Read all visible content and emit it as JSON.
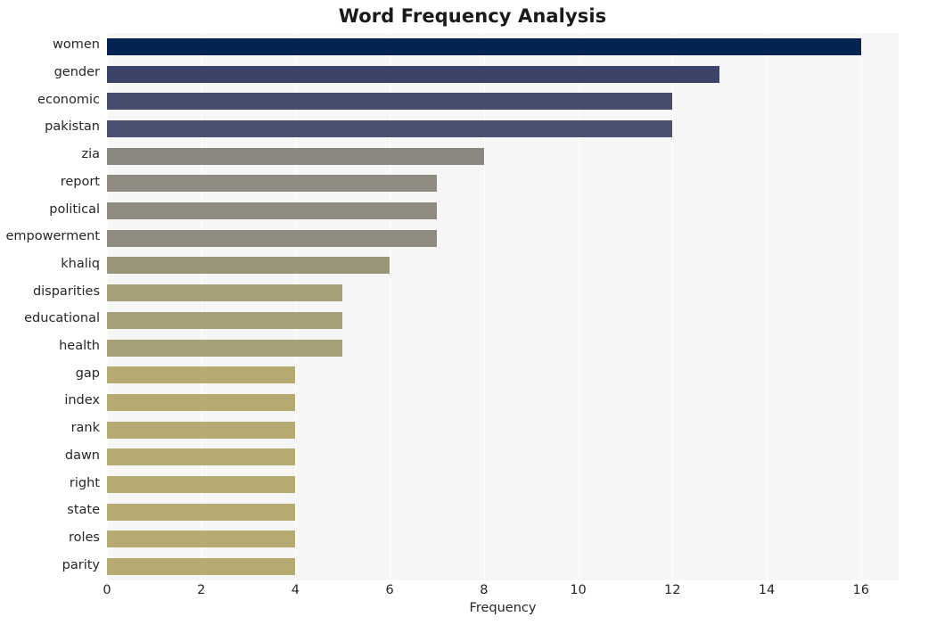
{
  "chart_data": {
    "type": "bar",
    "orientation": "horizontal",
    "title": "Word Frequency Analysis",
    "xlabel": "Frequency",
    "ylabel": "",
    "xlim": [
      0,
      16.8
    ],
    "xticks": [
      0,
      2,
      4,
      6,
      8,
      10,
      12,
      14,
      16
    ],
    "grid": "vertical",
    "legend": "none",
    "categories": [
      "women",
      "gender",
      "economic",
      "pakistan",
      "zia",
      "report",
      "political",
      "empowerment",
      "khaliq",
      "disparities",
      "educational",
      "health",
      "gap",
      "index",
      "rank",
      "dawn",
      "right",
      "state",
      "roles",
      "parity"
    ],
    "values": [
      16,
      13,
      12,
      12,
      8,
      7,
      7,
      7,
      6,
      5,
      5,
      5,
      4,
      4,
      4,
      4,
      4,
      4,
      4,
      4
    ],
    "bar_colors": [
      "#042351",
      "#3b4368",
      "#454c6e",
      "#4a5173",
      "#8a877f",
      "#8f8b81",
      "#8f8b81",
      "#8f8b81",
      "#9a9479",
      "#a79f77",
      "#a79f77",
      "#a79f77",
      "#b5ab72",
      "#b5ab72",
      "#b5ab72",
      "#b5ab72",
      "#b5ab72",
      "#b5ab72",
      "#b5ab72",
      "#b5ab72"
    ],
    "plot_background": "#f6f6f6",
    "grid_color": "#ffffff",
    "figure_background": "#ffffff"
  }
}
